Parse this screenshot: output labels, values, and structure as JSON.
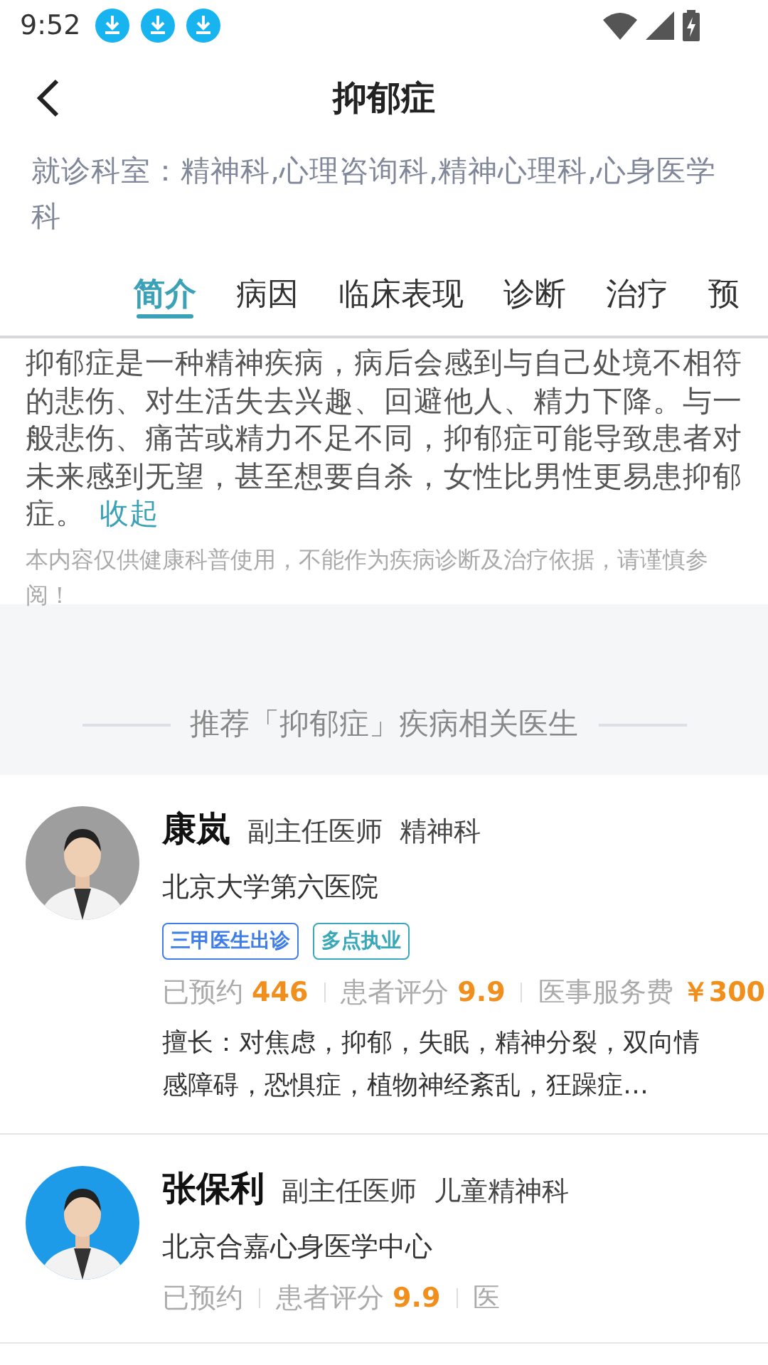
{
  "status_bar": {
    "time": "9:52",
    "notifications": [
      {
        "kind": "download"
      },
      {
        "kind": "download"
      },
      {
        "kind": "download"
      }
    ]
  },
  "header": {
    "title": "抑郁症"
  },
  "departments": "就诊科室：精神科,心理咨询科,精神心理科,心身医学科",
  "tabs": [
    {
      "label": "简介",
      "selected": true
    },
    {
      "label": "病因",
      "selected": false
    },
    {
      "label": "临床表现",
      "selected": false
    },
    {
      "label": "诊断",
      "selected": false
    },
    {
      "label": "治疗",
      "selected": false
    },
    {
      "label": "预",
      "selected": false
    }
  ],
  "intro": {
    "text": "抑郁症是一种精神疾病，病后会感到与自己处境不相符的悲伤、对生活失去兴趣、回避他人、精力下降。与一般悲伤、痛苦或精力不足不同，抑郁症可能导致患者对未来感到无望，甚至想要自杀，女性比男性更易患抑郁症。",
    "collapse_link": "收起",
    "disclaimer": "本内容仅供健康科普使用，不能作为疾病诊断及治疗依据，请谨慎参阅！"
  },
  "doctors_section": {
    "heading": "推荐「抑郁症」疾病相关医生"
  },
  "doctors": [
    {
      "name": "康岚",
      "title": "副主任医师",
      "department": "精神科",
      "hospital": "北京大学第六医院",
      "tags": [
        {
          "label": "三甲医生出诊",
          "color": "#3f7ee8"
        },
        {
          "label": "多点执业",
          "color": "#3aa8b8"
        }
      ],
      "stats": [
        {
          "label": "已预约",
          "value": "446"
        },
        {
          "label": "患者评分",
          "value": "9.9"
        },
        {
          "label": "医事服务费",
          "value": "￥300"
        }
      ],
      "expertise": "擅长：对焦虑，抑郁，失眠，精神分裂，双向情感障碍，恐惧症，植物神经紊乱，狂躁症…"
    },
    {
      "name": "张保利",
      "title": "副主任医师",
      "department": "儿童精神科",
      "hospital": "北京合嘉心身医学中心",
      "stats": [
        {
          "label": "已预约"
        },
        {
          "label": "患者评分",
          "value": "9.9"
        },
        {
          "label": "医"
        }
      ]
    }
  ]
}
